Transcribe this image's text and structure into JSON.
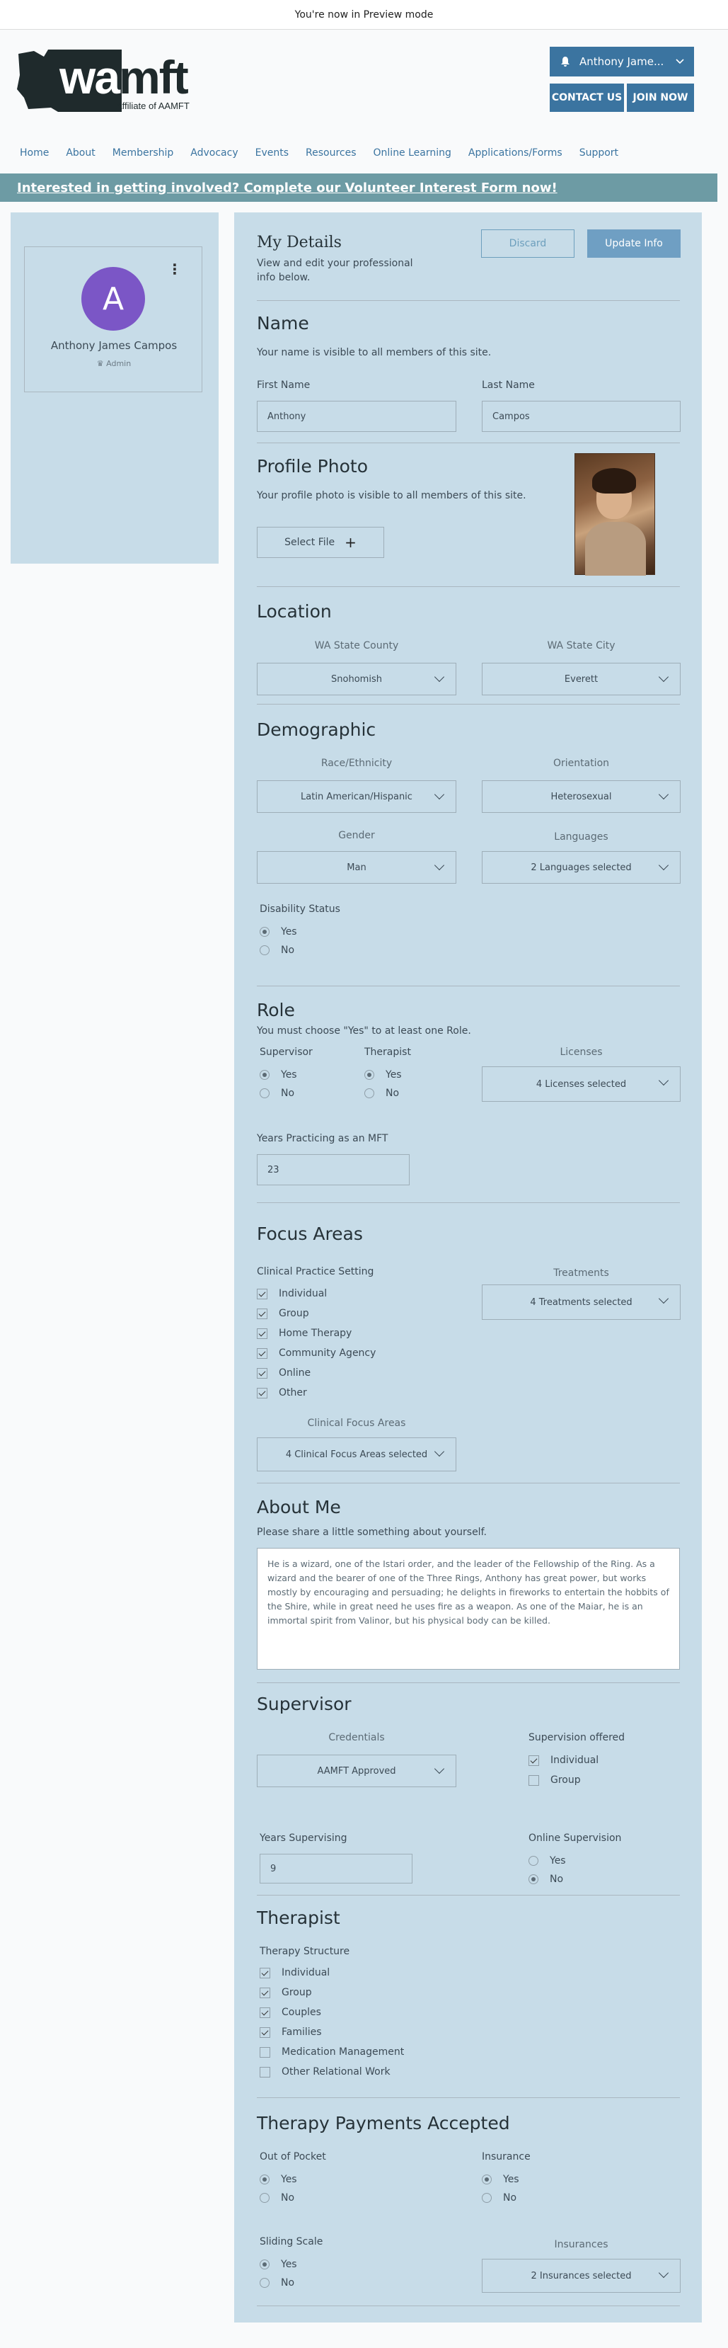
{
  "preview_bar": {
    "text": "You're now in Preview mode"
  },
  "header": {
    "logo_main_white": "wa",
    "logo_main_dark": "mft",
    "logo_sub": "Affiliate of AAMFT",
    "user_button": "Anthony Jame...",
    "contact_button": "CONTACT US",
    "join_button": "JOIN NOW",
    "nav": [
      "Home",
      "About",
      "Membership",
      "Advocacy",
      "Events",
      "Resources",
      "Online Learning",
      "Applications/Forms",
      "Support"
    ]
  },
  "banner": {
    "text": "Interested in getting involved? Complete our Volunteer Interest Form now!"
  },
  "profile_card": {
    "initial": "A",
    "name": "Anthony James Campos",
    "role": "Admin"
  },
  "my_details": {
    "title": "My Details",
    "subtitle": "View and edit your professional info below.",
    "discard": "Discard",
    "update": "Update Info"
  },
  "name_section": {
    "title": "Name",
    "desc": "Your name is visible to all members of this site.",
    "first_label": "First Name",
    "first_value": "Anthony",
    "last_label": "Last Name",
    "last_value": "Campos"
  },
  "photo_section": {
    "title": "Profile Photo",
    "desc": "Your profile photo is visible to all members of this site.",
    "select_file": "Select File"
  },
  "location": {
    "title": "Location",
    "county_label": "WA State County",
    "county_value": "Snohomish",
    "city_label": "WA State City",
    "city_value": "Everett"
  },
  "demographic": {
    "title": "Demographic",
    "race_label": "Race/Ethnicity",
    "race_value": "Latin American/Hispanic",
    "orientation_label": "Orientation",
    "orientation_value": "Heterosexual",
    "gender_label": "Gender",
    "gender_value": "Man",
    "languages_label": "Languages",
    "languages_value": "2 Languages selected",
    "disability_label": "Disability Status",
    "yes": "Yes",
    "no": "No"
  },
  "role": {
    "title": "Role",
    "desc": "You must choose \"Yes\" to at least one Role.",
    "supervisor_label": "Supervisor",
    "therapist_label": "Therapist",
    "licenses_label": "Licenses",
    "licenses_value": "4 Licenses selected",
    "years_label": "Years Practicing as an MFT",
    "years_value": "23",
    "yes": "Yes",
    "no": "No"
  },
  "focus": {
    "title": "Focus Areas",
    "setting_label": "Clinical Practice Setting",
    "settings": [
      "Individual",
      "Group",
      "Home Therapy",
      "Community Agency",
      "Online",
      "Other"
    ],
    "treatments_label": "Treatments",
    "treatments_value": "4 Treatments selected",
    "clinical_label": "Clinical Focus Areas",
    "clinical_value": "4 Clinical Focus Areas selected"
  },
  "about": {
    "title": "About Me",
    "desc": "Please share a little something about yourself.",
    "text": "He is a wizard, one of the Istari order, and the leader of the Fellowship of the Ring. As a wizard and the bearer of one of the Three Rings, Anthony has great power, but works mostly by encouraging and persuading; he delights in fireworks to entertain the hobbits of the Shire, while in great need he uses fire as a weapon. As one of the Maiar, he is an immortal spirit from Valinor, but his physical body can be killed."
  },
  "supervisor": {
    "title": "Supervisor",
    "credentials_label": "Credentials",
    "credentials_value": "AAMFT Approved",
    "offered_label": "Supervision offered",
    "offered": [
      "Individual",
      "Group"
    ],
    "years_label": "Years Supervising",
    "years_value": "9",
    "online_label": "Online Supervision",
    "yes": "Yes",
    "no": "No"
  },
  "therapist": {
    "title": "Therapist",
    "structure_label": "Therapy Structure",
    "structures": [
      "Individual",
      "Group",
      "Couples",
      "Families",
      "Medication Management",
      "Other Relational Work"
    ]
  },
  "payments": {
    "title": "Therapy Payments Accepted",
    "oop_label": "Out of Pocket",
    "insurance_label": "Insurance",
    "sliding_label": "Sliding Scale",
    "insurances_label": "Insurances",
    "insurances_value": "2 Insurances selected",
    "yes": "Yes",
    "no": "No"
  }
}
